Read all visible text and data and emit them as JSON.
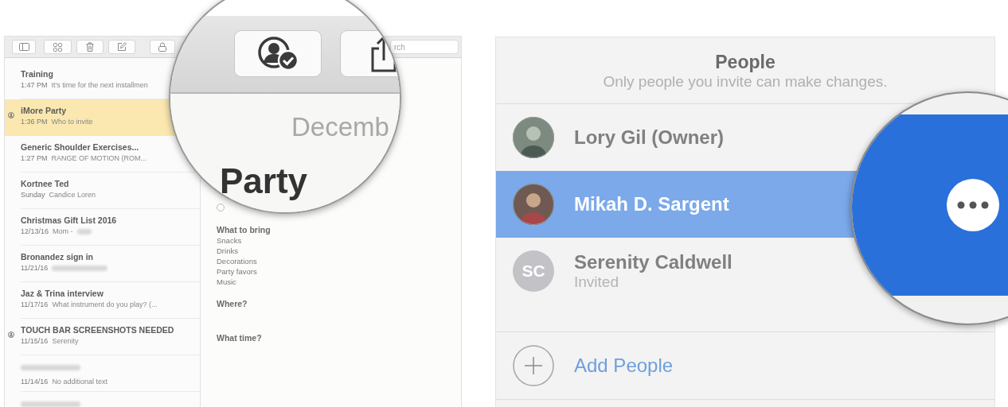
{
  "notes_window": {
    "toolbar": {
      "search": {
        "placeholder": "rch"
      }
    },
    "notes": [
      {
        "title": "Training",
        "date": "1:47 PM",
        "preview": "It's time for the next installmen",
        "shared": false,
        "selected": false
      },
      {
        "title": "iMore Party",
        "date": "1:36 PM",
        "preview": "Who to invite",
        "shared": true,
        "selected": true
      },
      {
        "title": "Generic Shoulder Exercises...",
        "date": "1:27 PM",
        "preview": "RANGE OF MOTION (ROM...",
        "shared": false,
        "selected": false
      },
      {
        "title": "Kortnee Ted",
        "date": "Sunday",
        "preview": "Candice Loren",
        "shared": false,
        "selected": false
      },
      {
        "title": "Christmas Gift List 2016",
        "date": "12/13/16",
        "preview": "Mom -",
        "preview_redacted": true,
        "shared": false,
        "selected": false
      },
      {
        "title": "Bronandez sign in",
        "date": "11/21/16",
        "preview_redacted": true,
        "shared": false,
        "selected": false
      },
      {
        "title": "Jaz & Trina interview",
        "date": "11/17/16",
        "preview": "What instrument do you play? (...",
        "shared": false,
        "selected": false
      },
      {
        "title": "TOUCH BAR SCREENSHOTS NEEDED",
        "date": "11/15/16",
        "preview": "Serenity",
        "shared": true,
        "selected": false
      },
      {
        "title_redacted": true,
        "date": "11/14/16",
        "preview": "No additional text",
        "shared": false,
        "selected": false
      },
      {
        "title_redacted": true,
        "shared": false,
        "selected": false
      }
    ],
    "note": {
      "date": "Decemb",
      "title": "Party",
      "reminder": {
        "checked": false
      },
      "sections": [
        {
          "heading": "What to bring",
          "lines": [
            "Snacks",
            "Drinks",
            "Decorations",
            "Party favors",
            "Music"
          ]
        },
        {
          "heading": "Where?"
        },
        {
          "heading": "What time?"
        }
      ]
    }
  },
  "people_panel": {
    "title": "People",
    "subtitle": "Only people you invite can make changes.",
    "people": [
      {
        "name": "Lory Gil (Owner)",
        "kind": "photo",
        "selected": false
      },
      {
        "name": "Mikah D. Sargent",
        "kind": "photo",
        "selected": true
      },
      {
        "name": "Serenity Caldwell",
        "kind": "initials",
        "initials": "SC",
        "status": "Invited",
        "selected": false
      }
    ],
    "add_label": "Add People"
  }
}
